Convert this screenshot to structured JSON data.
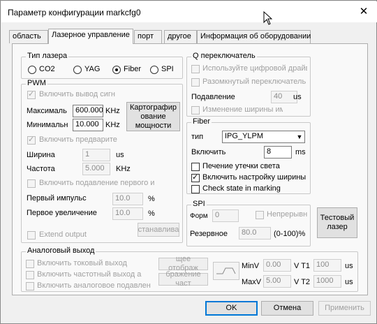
{
  "window": {
    "title": "Параметр конфигурации markcfg0",
    "close_glyph": "✕"
  },
  "tabs": [
    {
      "label": "область"
    },
    {
      "label": "Лазерное управление"
    },
    {
      "label": "порт"
    },
    {
      "label": "другое"
    },
    {
      "label": "Информация об оборудовании"
    }
  ],
  "laser_type": {
    "title": "Тип лазера",
    "options": [
      "CO2",
      "YAG",
      "Fiber",
      "SPI"
    ],
    "selected": "Fiber"
  },
  "pwm": {
    "title": "PWM",
    "enable_output": "Включить вывод сигн",
    "max_label": "Максималь",
    "max_value": "600.000",
    "max_unit": "KHz",
    "min_label": "Минимальн",
    "min_value": "10.000",
    "min_unit": "KHz",
    "mapping_button": "Картографир\nование\nмощности",
    "enable_preliminary": "Включить предварите",
    "width_label": "Ширина",
    "width_value": "1",
    "width_unit": "us",
    "freq_label": "Частота",
    "freq_value": "5.000",
    "freq_unit": "KHz",
    "suppress_first": "Включить подавление первого и",
    "first_pulse_label": "Первый импульс",
    "first_pulse_value": "10.0",
    "first_pulse_unit": "%",
    "first_increase_label": "Первое увеличение",
    "first_increase_value": "10.0",
    "first_increase_unit": "%",
    "set_button": "станавлива",
    "extend_output": "Extend output"
  },
  "q_switch": {
    "title": "Q переключатель",
    "use_digital": "Используйте цифровой драйв",
    "open_switch": "Разомкнутый переключатель",
    "suppression_label": "Подавление",
    "suppression_value": "40",
    "suppression_unit": "us",
    "change_width": "Изменение ширины имп"
  },
  "fiber": {
    "title": "Fiber",
    "type_label": "тип",
    "type_value": "IPG_YLPM",
    "enable_label": "Включить",
    "enable_value": "8",
    "enable_unit": "ms",
    "leak_treatment": "Печение утечки света",
    "enable_width_setting": "Включить настройку ширины и",
    "check_state": "Check state in marking",
    "leak_checked": false,
    "width_checked": true,
    "state_checked": false
  },
  "spi": {
    "title": "SPI",
    "form_label": "Форм",
    "form_value": "0",
    "continuous": "Непрерывн",
    "reserve_label": "Резервное",
    "reserve_value": "80.0",
    "reserve_range": "(0-100)%"
  },
  "test_laser_button": "Тестовый\nлазер",
  "analog": {
    "title": "Аналоговый выход",
    "enable_current": "Включить токовый выход",
    "enable_freq": "Включить частотный выход а",
    "enable_analog_suppress": "Включить аналоговое подавлен",
    "display_button_1": "щее отображ",
    "display_button_2": "бражение част",
    "minv_label": "MinV",
    "minv_value": "0.00",
    "maxv_label": "MaxV",
    "maxv_value": "5.00",
    "t1_label": "V  T1",
    "t1_value": "100",
    "t1_unit": "us",
    "t2_label": "V  T2",
    "t2_value": "1000",
    "t2_unit": "us"
  },
  "footer": {
    "ok": "OK",
    "cancel": "Отмена",
    "apply": "Применить"
  }
}
